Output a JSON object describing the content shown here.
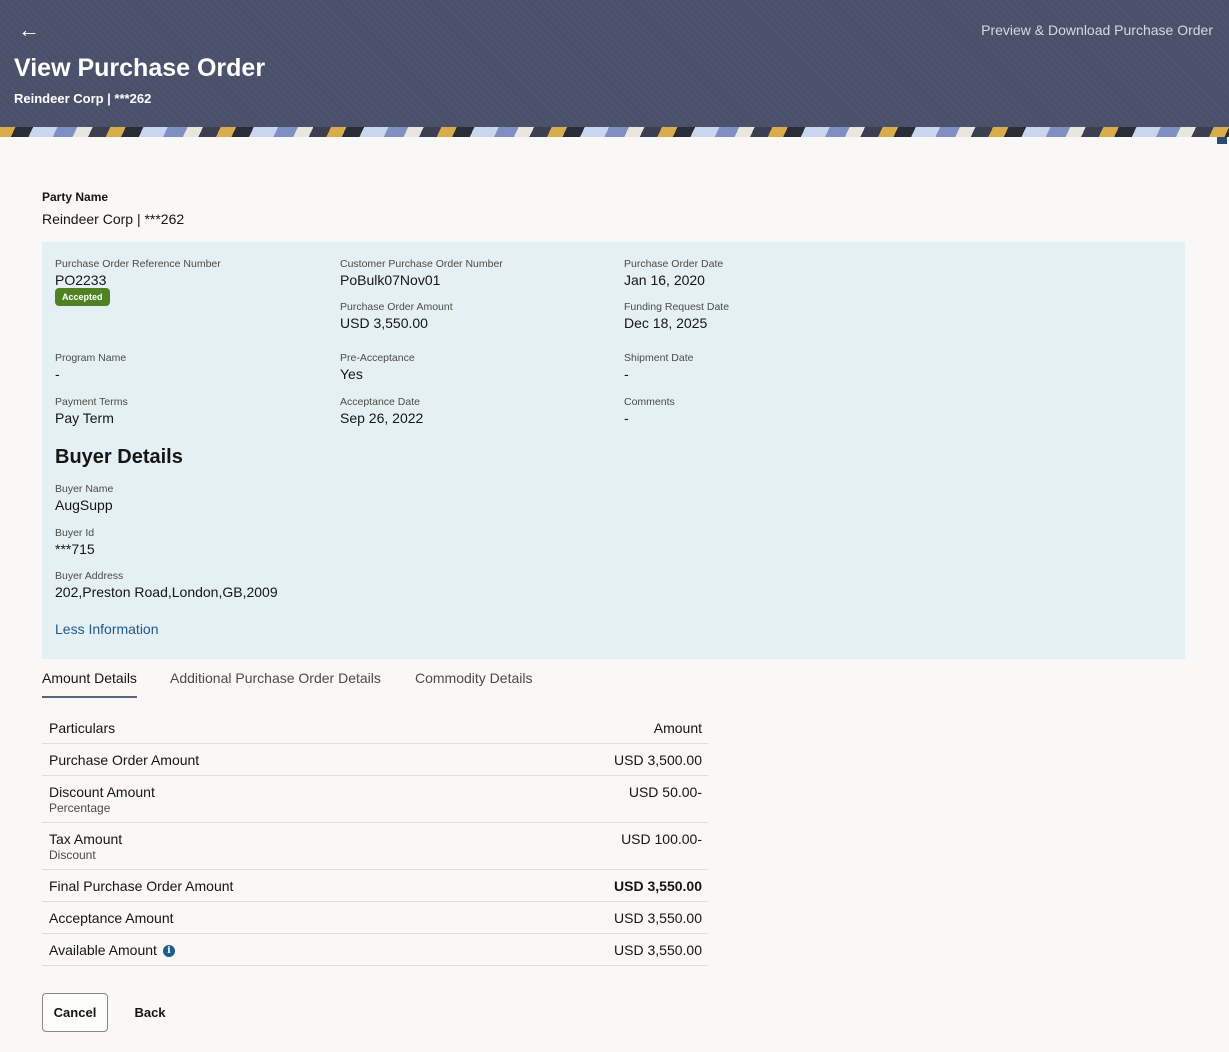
{
  "header": {
    "title": "View Purchase Order",
    "subtitle": "Reindeer Corp | ***262",
    "preview_link": "Preview & Download Purchase Order",
    "back_icon": "arrow-left-icon",
    "back_glyph": "←"
  },
  "party": {
    "label": "Party Name",
    "value": "Reindeer Corp | ***262"
  },
  "details": {
    "po_ref_label": "Purchase Order Reference Number",
    "po_ref_value": "PO2233",
    "status_badge": "Accepted",
    "customer_po_label": "Customer Purchase Order Number",
    "customer_po_value": "PoBulk07Nov01",
    "po_date_label": "Purchase Order Date",
    "po_date_value": "Jan 16, 2020",
    "po_amount_label": "Purchase Order Amount",
    "po_amount_value": "USD 3,550.00",
    "funding_date_label": "Funding Request Date",
    "funding_date_value": "Dec 18, 2025",
    "program_label": "Program Name",
    "program_value": "-",
    "pre_acceptance_label": "Pre-Acceptance",
    "pre_acceptance_value": "Yes",
    "shipment_label": "Shipment Date",
    "shipment_value": "-",
    "payment_terms_label": "Payment Terms",
    "payment_terms_value": "Pay Term",
    "acceptance_date_label": "Acceptance Date",
    "acceptance_date_value": "Sep 26, 2022",
    "comments_label": "Comments",
    "comments_value": "-"
  },
  "buyer": {
    "heading": "Buyer Details",
    "name_label": "Buyer Name",
    "name_value": "AugSupp",
    "id_label": "Buyer Id",
    "id_value": "***715",
    "address_label": "Buyer Address",
    "address_value": "202,Preston Road,London,GB,2009",
    "less_info": "Less Information"
  },
  "tabs": [
    {
      "label": "Amount Details",
      "active": true
    },
    {
      "label": "Additional Purchase Order Details",
      "active": false
    },
    {
      "label": "Commodity Details",
      "active": false
    }
  ],
  "amount_table": {
    "header_particulars": "Particulars",
    "header_amount": "Amount",
    "rows": [
      {
        "particular": "Purchase Order Amount",
        "sub": "",
        "amount": "USD 3,500.00"
      },
      {
        "particular": "Discount Amount",
        "sub": "Percentage",
        "amount": "USD 50.00-"
      },
      {
        "particular": "Tax Amount",
        "sub": "Discount",
        "amount": "USD 100.00-"
      },
      {
        "particular": "Final Purchase Order Amount",
        "sub": "",
        "amount": "USD 3,550.00"
      },
      {
        "particular": "Acceptance Amount",
        "sub": "",
        "amount": "USD 3,550.00"
      },
      {
        "particular": "Available Amount",
        "sub": "",
        "amount": "USD 3,550.00"
      }
    ],
    "info_icon": "info-icon",
    "info_glyph": "i"
  },
  "actions": {
    "cancel": "Cancel",
    "back": "Back"
  },
  "colors": {
    "header_bg": "#4a4f6a",
    "panel_bg": "#e4f0f4",
    "accepted_badge": "#508223",
    "link": "#1e5a8a"
  }
}
